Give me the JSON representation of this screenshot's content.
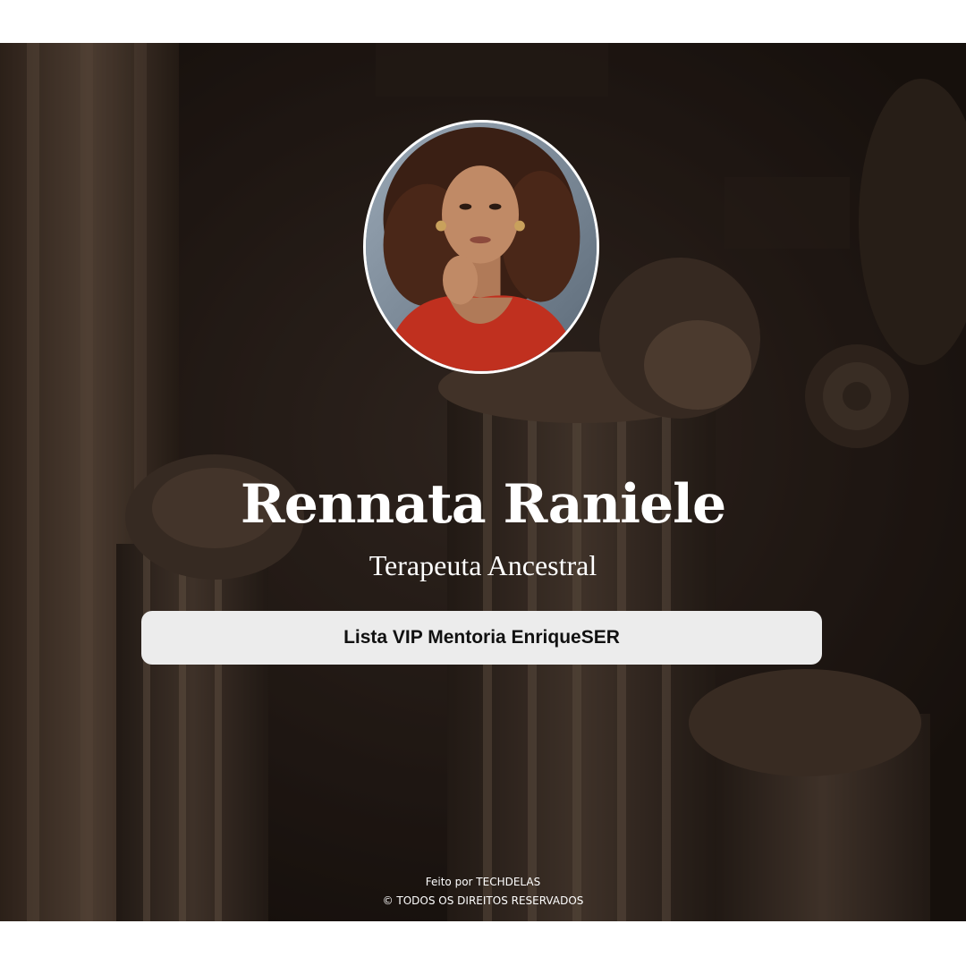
{
  "profile": {
    "name": "Rennata Raniele",
    "subtitle": "Terapeuta Ancestral",
    "avatar_icon": "profile-photo"
  },
  "links": [
    {
      "label": "Lista VIP Mentoria EnriqueSER"
    }
  ],
  "footer": {
    "made_by": "Feito por TECHDELAS",
    "copyright": "© TODOS OS DIREITOS RESERVADOS"
  },
  "colors": {
    "page_background": "#ffffff",
    "hero_background": "#221a15",
    "text": "#ffffff",
    "button_background": "#ececec",
    "button_text": "#111111"
  }
}
